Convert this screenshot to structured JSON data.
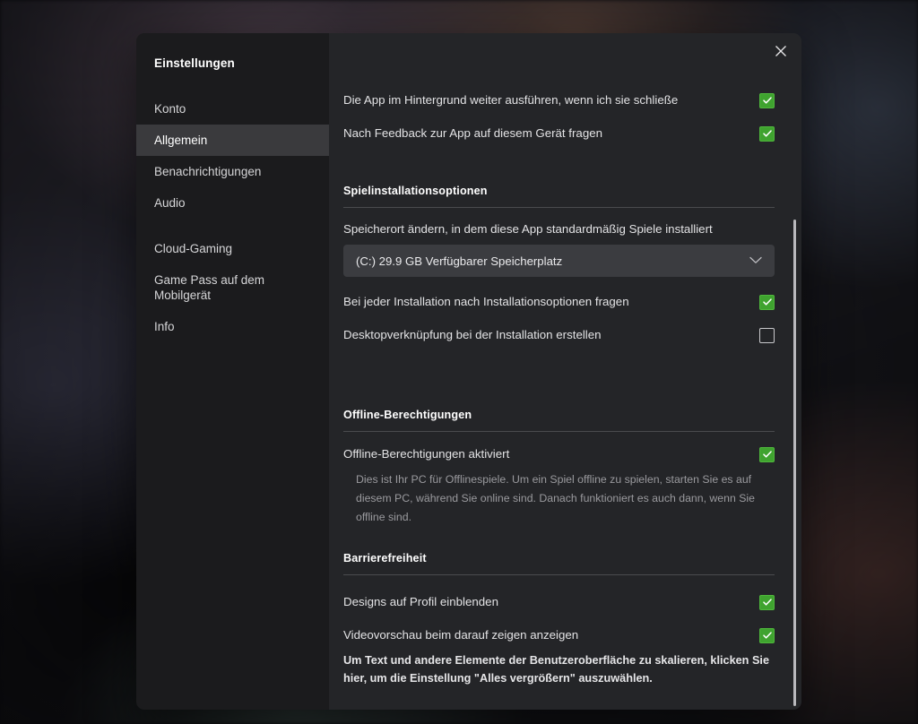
{
  "window": {
    "title": "Einstellungen",
    "close_icon": "close-icon"
  },
  "sidebar": {
    "items": [
      {
        "label": "Konto",
        "active": false
      },
      {
        "label": "Allgemein",
        "active": true
      },
      {
        "label": "Benachrichtigungen",
        "active": false
      },
      {
        "label": "Audio",
        "active": false
      },
      {
        "label": "Cloud-Gaming",
        "active": false
      },
      {
        "label": "Game Pass auf dem Mobilgerät",
        "active": false
      },
      {
        "label": "Info",
        "active": false
      }
    ]
  },
  "content": {
    "top_toggles": [
      {
        "label": "Die App im Hintergrund weiter ausführen, wenn ich sie schließe",
        "checked": true
      },
      {
        "label": "Nach Feedback zur App auf diesem Gerät fragen",
        "checked": true
      }
    ],
    "install_section": {
      "heading": "Spielinstallationsoptionen",
      "storage_label": "Speicherort ändern, in dem diese App standardmäßig Spiele installiert",
      "dropdown_value": "(C:) 29.9 GB Verfügbarer Speicherplatz",
      "dropdown_icon": "chevron-down-icon",
      "toggles": [
        {
          "label": "Bei jeder Installation nach Installationsoptionen fragen",
          "checked": true
        },
        {
          "label": "Desktopverknüpfung bei der Installation erstellen",
          "checked": false
        }
      ]
    },
    "offline_section": {
      "heading": "Offline-Berechtigungen",
      "toggle": {
        "label": "Offline-Berechtigungen aktiviert",
        "checked": true
      },
      "help": "Dies ist Ihr PC für Offlinespiele. Um ein Spiel offline zu spielen, starten Sie es auf diesem PC, während Sie online sind. Danach funktioniert es auch dann, wenn Sie offline sind."
    },
    "accessibility_section": {
      "heading": "Barrierefreiheit",
      "toggles": [
        {
          "label": "Designs auf Profil einblenden",
          "checked": true
        },
        {
          "label": "Videovorschau beim darauf zeigen anzeigen",
          "checked": true
        }
      ],
      "scale_link": "Um Text und andere Elemente der Benutzeroberfläche zu skalieren, klicken Sie hier, um die Einstellung \"Alles vergrößern\" auszuwählen."
    }
  },
  "colors": {
    "accent_green": "#3fa32f",
    "dialog_bg": "#242528",
    "sidebar_bg": "#1b1b1d",
    "active_item_bg": "#3a3a3d"
  }
}
